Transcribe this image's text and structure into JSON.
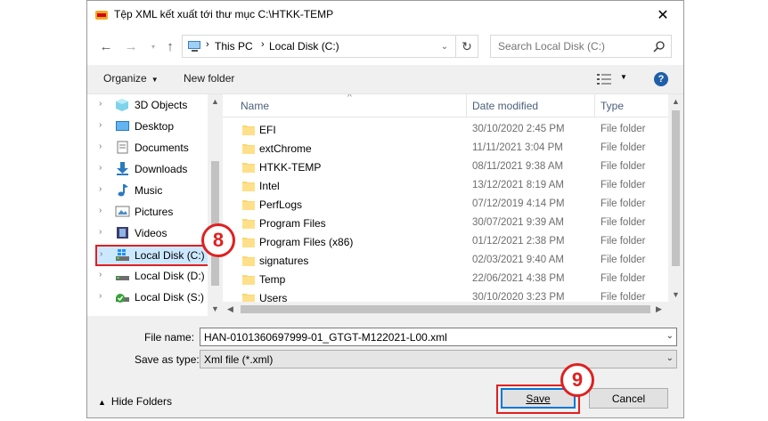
{
  "window": {
    "title": "Tệp XML kết xuất tới thư mục C:\\HTKK-TEMP",
    "close_symbol": "✕"
  },
  "navigation": {
    "back_icon": "arrow-left-icon",
    "forward_icon": "arrow-right-icon",
    "up_icon": "arrow-up-icon",
    "breadcrumb": [
      "This PC",
      "Local Disk (C:)"
    ],
    "search_placeholder": "Search Local Disk (C:)"
  },
  "toolbar": {
    "organize_label": "Organize",
    "new_folder_label": "New folder",
    "help_label": "?"
  },
  "sidebar": {
    "items": [
      {
        "label": "3D Objects",
        "icon": "cube-3d-icon"
      },
      {
        "label": "Desktop",
        "icon": "desktop-icon"
      },
      {
        "label": "Documents",
        "icon": "documents-icon"
      },
      {
        "label": "Downloads",
        "icon": "download-arrow-icon"
      },
      {
        "label": "Music",
        "icon": "music-note-icon"
      },
      {
        "label": "Pictures",
        "icon": "pictures-icon"
      },
      {
        "label": "Videos",
        "icon": "video-film-icon"
      },
      {
        "label": "Local Disk (C:)",
        "icon": "windows-drive-icon",
        "selected": true
      },
      {
        "label": "Local Disk (D:)",
        "icon": "drive-icon"
      },
      {
        "label": "Local Disk (S:)",
        "icon": "drive-check-icon"
      }
    ]
  },
  "file_list": {
    "columns": {
      "name": "Name",
      "date": "Date modified",
      "type": "Type"
    },
    "rows": [
      {
        "name": "EFI",
        "date": "30/10/2020 2:45 PM",
        "type": "File folder"
      },
      {
        "name": "extChrome",
        "date": "11/11/2021 3:04 PM",
        "type": "File folder"
      },
      {
        "name": "HTKK-TEMP",
        "date": "08/11/2021 9:38 AM",
        "type": "File folder"
      },
      {
        "name": "Intel",
        "date": "13/12/2021 8:19 AM",
        "type": "File folder"
      },
      {
        "name": "PerfLogs",
        "date": "07/12/2019 4:14 PM",
        "type": "File folder"
      },
      {
        "name": "Program Files",
        "date": "30/07/2021 9:39 AM",
        "type": "File folder"
      },
      {
        "name": "Program Files (x86)",
        "date": "01/12/2021 2:38 PM",
        "type": "File folder"
      },
      {
        "name": "signatures",
        "date": "02/03/2021 9:40 AM",
        "type": "File folder"
      },
      {
        "name": "Temp",
        "date": "22/06/2021 4:38 PM",
        "type": "File folder"
      },
      {
        "name": "Users",
        "date": "30/10/2020 3:23 PM",
        "type": "File folder"
      }
    ]
  },
  "save_form": {
    "file_name_label": "File name:",
    "file_name_value": "HAN-0101360697999-01_GTGT-M122021-L00.xml",
    "save_as_type_label": "Save as type:",
    "save_as_type_value": "Xml file (*.xml)",
    "hide_folders_label": "Hide Folders",
    "save_label": "Save",
    "cancel_label": "Cancel"
  },
  "annotations": {
    "step_local_disk": "8",
    "step_save": "9",
    "highlight_color": "#e02020"
  }
}
